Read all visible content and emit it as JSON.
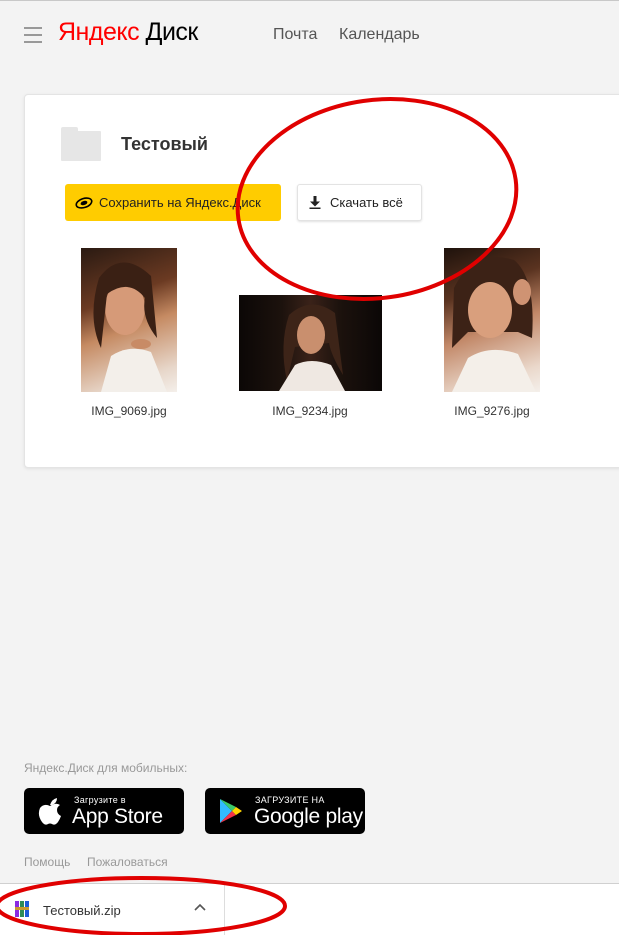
{
  "header": {
    "logo_yandex": "Яндекс",
    "logo_disk": "Диск",
    "nav": [
      "Почта",
      "Календарь"
    ]
  },
  "folder": {
    "title": "Тестовый",
    "save_button": "Сохранить на Яндекс.Диск",
    "download_all_button": "Скачать всё",
    "files": [
      {
        "name": "IMG_9069.jpg"
      },
      {
        "name": "IMG_9234.jpg"
      },
      {
        "name": "IMG_9276.jpg"
      }
    ]
  },
  "footer": {
    "mobile_label": "Яндекс.Диск для мобильных:",
    "appstore_small": "Загрузите в",
    "appstore_big": "App Store",
    "googleplay_small": "ЗАГРУЗИТЕ НА",
    "googleplay_big": "Google play",
    "links": [
      "Помощь",
      "Пожаловаться"
    ]
  },
  "download_bar": {
    "file_name": "Тестовый.zip"
  },
  "colors": {
    "logo_red": "#ff0000",
    "save_button_yellow": "#ffcc00",
    "annotation_red": "#e00000"
  }
}
